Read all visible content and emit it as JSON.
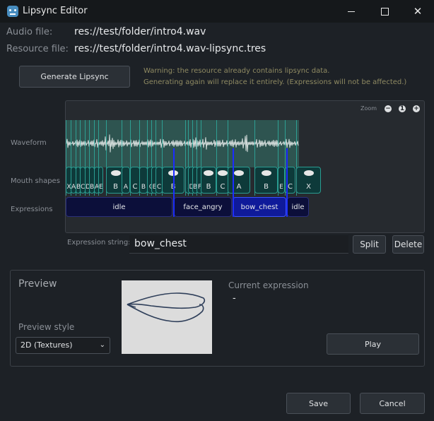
{
  "window": {
    "title": "Lipsync Editor",
    "min_glyph": "",
    "max_glyph": "",
    "close_glyph": "✕"
  },
  "audio_file": {
    "label": "Audio file:",
    "value": "res://test/folder/intro4.wav"
  },
  "resource_file": {
    "label": "Resource file:",
    "value": "res://test/folder/intro4.wav-lipsync.tres"
  },
  "generate_button": "Generate Lipsync",
  "warning": {
    "line1": "Warning: the resource already contains lipsync data.",
    "line2": "Generating again will replace it entirely. (Expressions will not be affected.)"
  },
  "timeline": {
    "zoom_label": "Zoom",
    "zoom_out": "−",
    "zoom_reset": "1",
    "zoom_in": "+",
    "tracks": {
      "waveform": "Waveform",
      "mouth_shapes": "Mouth shapes",
      "expressions": "Expressions"
    },
    "mouth_shapes": [
      "X",
      "A",
      "B",
      "C",
      "D",
      "B",
      "A",
      "E",
      "B",
      "A",
      "C",
      "B",
      "C",
      "E",
      "C",
      "B",
      "X",
      "D",
      "B",
      "F",
      "B",
      "C",
      "A",
      "B",
      "E",
      "C",
      "X",
      "X"
    ],
    "expressions": [
      "idle",
      "face_angry",
      "bow_chest",
      "idle"
    ],
    "selected_expression": "bow_chest"
  },
  "expression_string": {
    "label": "Expression string:",
    "value": "bow_chest"
  },
  "split_button": "Split",
  "delete_button": "Delete",
  "preview": {
    "title": "Preview",
    "style_label": "Preview style",
    "style_value": "2D (Textures)",
    "current_expression_label": "Current expression",
    "current_expression_value": "-",
    "play_button": "Play"
  },
  "save_button": "Save",
  "cancel_button": "Cancel",
  "colors": {
    "background": "#1d2126",
    "waveform_area": "#2e5450",
    "mouth_block": "#0e3a3a",
    "expression_block": "#0c0f3a",
    "selected_expression": "#0f1a9a",
    "warning_text": "#8f8a62"
  }
}
